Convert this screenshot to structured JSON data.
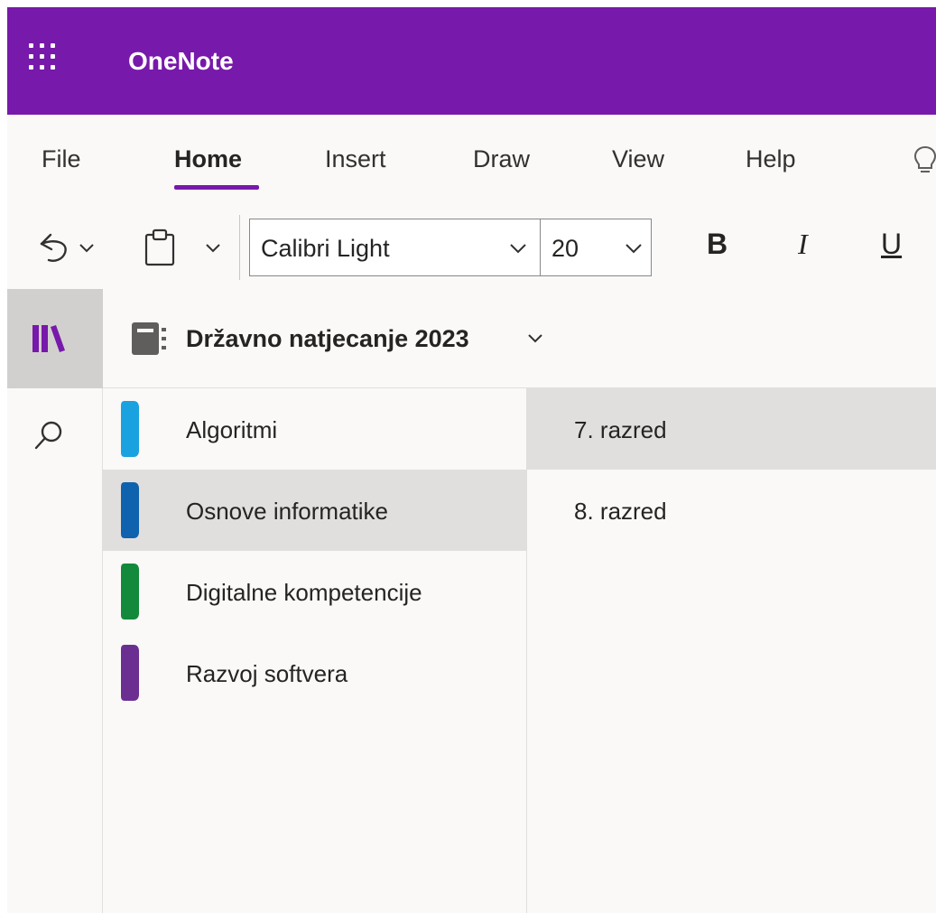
{
  "app": {
    "title": "OneNote",
    "accent_color": "#7719aa"
  },
  "menu": {
    "tabs": [
      {
        "label": "File"
      },
      {
        "label": "Home",
        "active": true
      },
      {
        "label": "Insert"
      },
      {
        "label": "Draw"
      },
      {
        "label": "View"
      },
      {
        "label": "Help"
      }
    ],
    "tell_me_icon": "lightbulb-icon"
  },
  "toolbar": {
    "undo_icon": "undo-icon",
    "paste_icon": "clipboard-icon",
    "font_name": "Calibri Light",
    "font_size": "20",
    "bold_label": "B",
    "italic_label": "I",
    "underline_label": "U"
  },
  "rail": {
    "notebooks_icon": "library-icon",
    "search_icon": "search-icon"
  },
  "notebook": {
    "title": "Državno natjecanje 2023",
    "icon": "notebook-icon"
  },
  "sections": [
    {
      "label": "Algoritmi",
      "color": "#1aa1e0"
    },
    {
      "label": "Osnove informatike",
      "color": "#0f62ad",
      "selected": true
    },
    {
      "label": "Digitalne kompetencije",
      "color": "#13893c"
    },
    {
      "label": "Razvoj softvera",
      "color": "#6b2f91"
    }
  ],
  "pages": [
    {
      "label": "7. razred",
      "selected": true
    },
    {
      "label": "8. razred"
    }
  ]
}
